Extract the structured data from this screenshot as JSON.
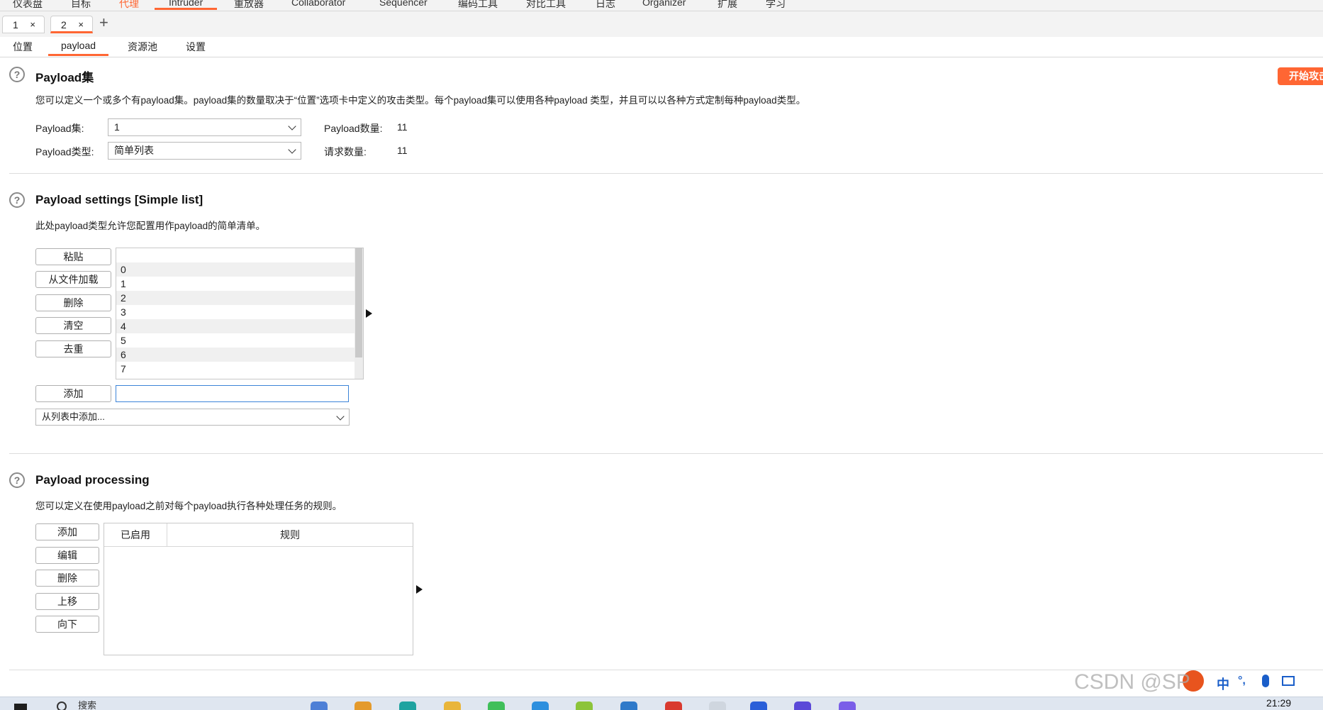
{
  "top_menu": {
    "items": [
      "仪表盘",
      "目标",
      "代理",
      "Intruder",
      "重放器",
      "Collaborator",
      "Sequencer",
      "编码工具",
      "对比工具",
      "日志",
      "Organizer",
      "扩展",
      "学习"
    ],
    "active_index": 2,
    "selected_index": 3
  },
  "instance_tabs": {
    "tabs": [
      {
        "label": "1",
        "close": "×"
      },
      {
        "label": "2",
        "close": "×"
      }
    ],
    "new_tab": "+"
  },
  "sub_tabs": [
    "位置",
    "payload",
    "资源池",
    "设置"
  ],
  "start_attack_button": "开始攻击",
  "payload_sets": {
    "title": "Payload集",
    "description": "您可以定义一个或多个有payload集。payload集的数量取决于“位置”选项卡中定义的攻击类型。每个payload集可以使用各种payload 类型，并且可以以各种方式定制每种payload类型。",
    "set_label": "Payload集:",
    "set_value": "1",
    "type_label": "Payload类型:",
    "type_value": "简单列表",
    "count_label": "Payload数量:",
    "count_value": "11",
    "requests_label": "请求数量:",
    "requests_value": "11"
  },
  "payload_settings": {
    "title": "Payload settings [Simple list]",
    "description": "此处payload类型允许您配置用作payload的简单清单。",
    "buttons": {
      "paste": "粘贴",
      "load": "从文件加载",
      "remove": "删除",
      "clear": "清空",
      "dedupe": "去重",
      "add": "添加"
    },
    "list_items": [
      "0",
      "1",
      "2",
      "3",
      "4",
      "5",
      "6",
      "7"
    ],
    "add_input_value": "",
    "add_from_list": "从列表中添加..."
  },
  "payload_processing": {
    "title": "Payload processing",
    "description": "您可以定义在使用payload之前对每个payload执行各种处理任务的规则。",
    "buttons": {
      "add": "添加",
      "edit": "编辑",
      "remove": "删除",
      "up": "上移",
      "down": "向下"
    },
    "columns": [
      "已启用",
      "规则"
    ]
  },
  "taskbar": {
    "search_text": "搜索",
    "time": "21:29",
    "icons": [
      "windows-start-icon",
      "search-icon",
      "mail-app-icon",
      "chrome-icon",
      "edge-icon",
      "folder-icon",
      "wechat-icon",
      "maps-icon",
      "app-icon",
      "store-icon",
      "wps-icon",
      "app-icon-2",
      "pdf-icon",
      "app-icon-3",
      "vs-icon"
    ]
  },
  "watermark": "CSDN @SP",
  "ime": {
    "lang": "中",
    "punct": "°,"
  },
  "colors": {
    "accent": "#ff6633",
    "input_focus": "#3c84d8"
  }
}
